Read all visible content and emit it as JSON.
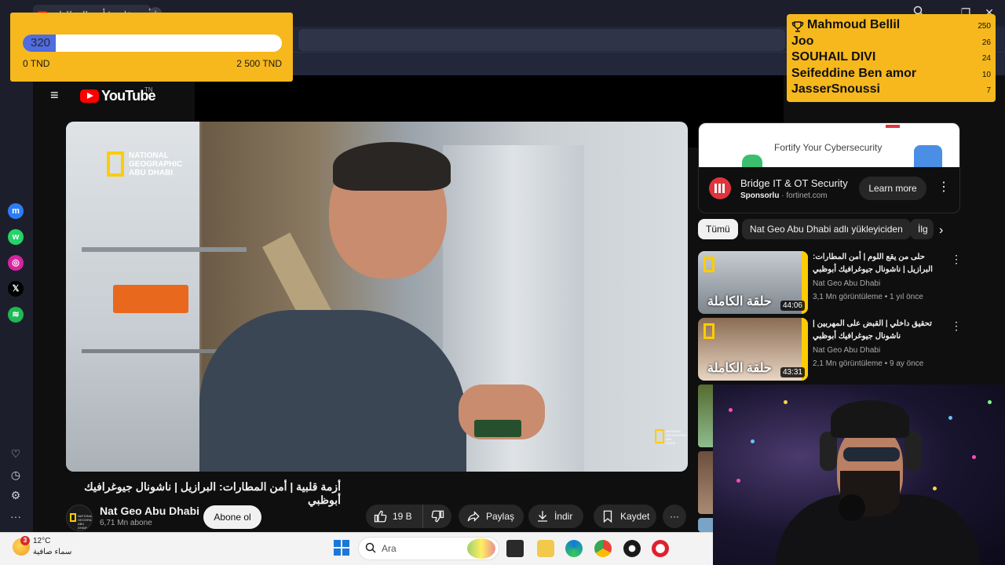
{
  "browser": {
    "tab_title": "أزمة قلبية | أمن المطارات",
    "new_tab": "+",
    "minimize": "—",
    "maximize": "❐",
    "close": "✕"
  },
  "sidebar": {
    "items": [
      {
        "name": "messenger",
        "color": "#2d7cf6",
        "glyph": "m"
      },
      {
        "name": "whatsapp",
        "color": "#25d366",
        "glyph": "w"
      },
      {
        "name": "instagram",
        "color": "#d6249f",
        "glyph": "◎"
      },
      {
        "name": "x",
        "color": "#000000",
        "glyph": "𝕏"
      },
      {
        "name": "spotify",
        "color": "#1db954",
        "glyph": "≋"
      }
    ],
    "bottom": [
      "♡",
      "◷",
      "⚙",
      "···"
    ]
  },
  "youtube": {
    "logo_text": "YouTube",
    "country": "TN"
  },
  "video": {
    "watermark": "NATIONAL GEOGRAPHIC ABU DHABI",
    "title": "أزمة قلبية | أمن المطارات: البرازيل | ناشونال جيوغرافيك أبوظبي",
    "channel": "Nat Geo Abu Dhabi",
    "subscribers": "6,71 Mn abone",
    "subscribe_label": "Abone ol",
    "likes": "19 B",
    "share_label": "Paylaş",
    "download_label": "İndir",
    "save_label": "Kaydet",
    "more": "···"
  },
  "ad": {
    "banner_text": "Fortify Your Cybersecurity",
    "title": "Bridge IT & OT Security",
    "sponsor_label": "Sponsorlu",
    "domain": "· fortinet.com",
    "cta": "Learn more",
    "more": "⋮"
  },
  "chips": {
    "all": "Tümü",
    "uploader": "Nat Geo Abu Dhabi adlı yükleyiciden",
    "more": "İlg",
    "next": "›"
  },
  "recommendations": [
    {
      "title": "حلى من يقع اللوم | أمن المطارات: البرازيل | ناشونال جيوغرافيك أبوظبي",
      "channel": "Nat Geo Abu Dhabi",
      "meta": "3,1 Mn görüntüleme • 1 yıl önce",
      "duration": "44:06",
      "caption": "حلقة الكاملة"
    },
    {
      "title": "تحقيق داخلي | القبض على المهربين | ناشونال جيوغرافيك أبوظبي",
      "channel": "Nat Geo Abu Dhabi",
      "meta": "2,1 Mn görüntüleme • 9 ay önce",
      "duration": "43:31",
      "caption": "حلقة الكاملة"
    }
  ],
  "goal": {
    "current": "320",
    "min_label": "0 TND",
    "max_label": "2 500 TND",
    "progress_fraction": 0.128,
    "bar_color": "#4f6ce0",
    "bg_color": "#f6b81d"
  },
  "leaderboard": [
    {
      "name": "Mahmoud Bellil",
      "amount": "250"
    },
    {
      "name": "Joo",
      "amount": "26"
    },
    {
      "name": "SOUHAIL DIVI",
      "amount": "24"
    },
    {
      "name": "Seifeddine Ben amor",
      "amount": "10"
    },
    {
      "name": "JasserSnoussi",
      "amount": "7"
    }
  ],
  "taskbar": {
    "weather_badge": "3",
    "temperature": "12°C",
    "condition": "سماء صافية",
    "search_placeholder": "Ara"
  }
}
